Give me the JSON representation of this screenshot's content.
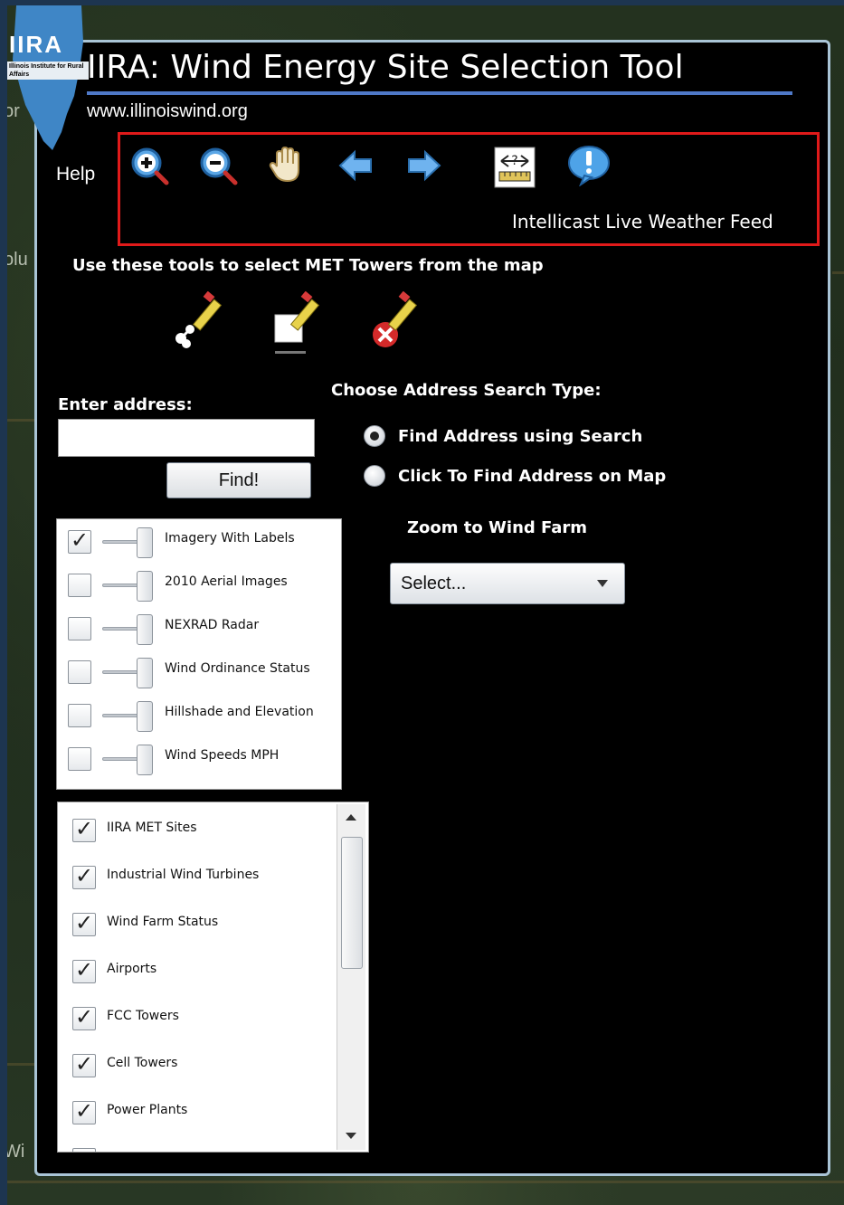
{
  "map": {
    "labels": [
      "or",
      "olu",
      "Wi"
    ]
  },
  "header": {
    "logo_text": "IIRA",
    "logo_sub": "Illinois Institute for Rural Affairs",
    "title": "IIRA: Wind Energy Site Selection Tool",
    "url": "www.illinoiswind.org",
    "help_label": "Help"
  },
  "toolbar": {
    "tools": [
      "zoom-in-icon",
      "zoom-out-icon",
      "pan-hand-icon",
      "back-arrow-icon",
      "forward-arrow-icon",
      "measure-icon",
      "info-icon"
    ],
    "weather_link": "Intellicast Live Weather Feed"
  },
  "select_tools": {
    "label": "Use these tools to select MET Towers from the map",
    "tools": [
      "select-by-point-icon",
      "select-by-rectangle-icon",
      "clear-selection-icon"
    ]
  },
  "address": {
    "label": "Enter address:",
    "value": "",
    "find_label": "Find!"
  },
  "search_type": {
    "label": "Choose Address Search Type:",
    "options": [
      {
        "label": "Find Address using Search",
        "selected": true
      },
      {
        "label": "Click To Find Address on Map",
        "selected": false
      }
    ]
  },
  "zoom_wind_farm": {
    "label": "Zoom to Wind Farm",
    "selected": "Select..."
  },
  "base_layers": [
    {
      "label": "Imagery With Labels",
      "checked": true
    },
    {
      "label": "2010 Aerial Images",
      "checked": false
    },
    {
      "label": "NEXRAD Radar",
      "checked": false
    },
    {
      "label": "Wind Ordinance Status",
      "checked": false
    },
    {
      "label": "Hillshade and Elevation",
      "checked": false
    },
    {
      "label": "Wind Speeds MPH",
      "checked": false
    }
  ],
  "overlay_layers": [
    {
      "label": "IIRA MET Sites",
      "checked": true
    },
    {
      "label": "Industrial Wind Turbines",
      "checked": true
    },
    {
      "label": "Wind Farm Status",
      "checked": true
    },
    {
      "label": "Airports",
      "checked": true
    },
    {
      "label": "FCC Towers",
      "checked": true
    },
    {
      "label": "Cell Towers",
      "checked": true
    },
    {
      "label": "Power Plants",
      "checked": true
    }
  ],
  "colors": {
    "panel_bg": "#000000",
    "panel_border": "#a9c4d6",
    "toolbar_highlight": "#e01a1a",
    "title_underline": "#4f79c8"
  }
}
